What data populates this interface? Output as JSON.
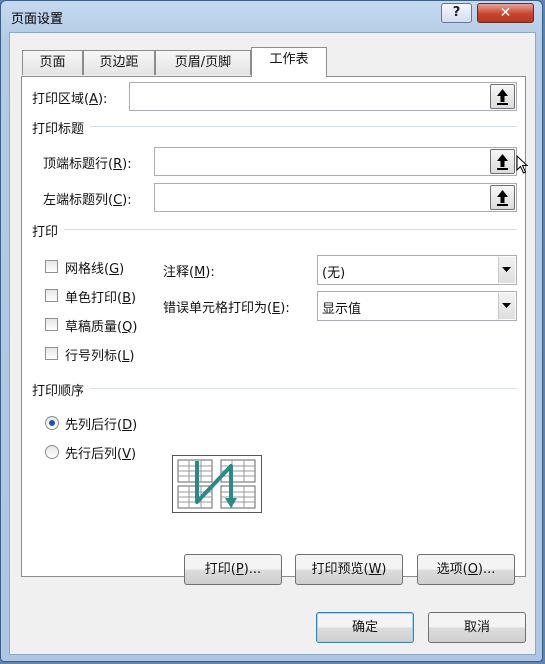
{
  "window": {
    "title": "页面设置",
    "help": "?",
    "close": "✕"
  },
  "tabs": [
    "页面",
    "页边距",
    "页眉/页脚",
    "工作表"
  ],
  "print_area": {
    "label_pre": "打印区域(",
    "key": "A",
    "label_post": "):",
    "value": ""
  },
  "print_titles": {
    "section": "打印标题",
    "rows": {
      "label_pre": "顶端标题行(",
      "key": "R",
      "label_post": "):",
      "value": ""
    },
    "cols": {
      "label_pre": "左端标题列(",
      "key": "C",
      "label_post": "):",
      "value": ""
    }
  },
  "print": {
    "section": "打印",
    "checkboxes": [
      {
        "pre": "网格线(",
        "key": "G",
        "post": ")",
        "checked": false
      },
      {
        "pre": "单色打印(",
        "key": "B",
        "post": ")",
        "checked": false
      },
      {
        "pre": "草稿质量(",
        "key": "Q",
        "post": ")",
        "checked": false
      },
      {
        "pre": "行号列标(",
        "key": "L",
        "post": ")",
        "checked": false
      }
    ],
    "comments": {
      "pre": "注释(",
      "key": "M",
      "post": "):",
      "value": "(无)"
    },
    "errors": {
      "pre": "错误单元格打印为(",
      "key": "E",
      "post": "):",
      "value": "显示值"
    }
  },
  "order": {
    "section": "打印顺序",
    "options": [
      {
        "pre": "先列后行(",
        "key": "D",
        "post": ")",
        "selected": true
      },
      {
        "pre": "先行后列(",
        "key": "V",
        "post": ")",
        "selected": false
      }
    ]
  },
  "buttons": {
    "print": {
      "pre": "打印(",
      "key": "P",
      "post": ")..."
    },
    "preview": {
      "pre": "打印预览(",
      "key": "W",
      "post": ")"
    },
    "options": {
      "pre": "选项(",
      "key": "O",
      "post": ")..."
    },
    "ok": "确定",
    "cancel": "取消"
  },
  "colors": {
    "accent": "#1b57a8",
    "arrow": "#2a8a8a",
    "titlebar": "#b9cfe8"
  }
}
